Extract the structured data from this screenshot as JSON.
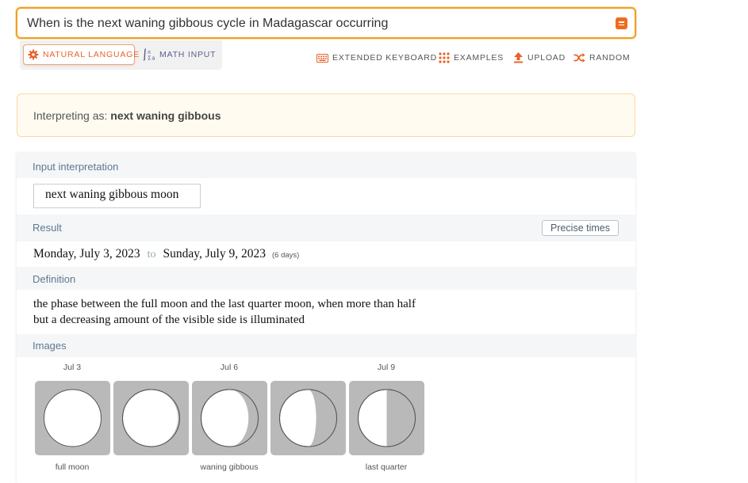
{
  "search": {
    "query": "When is the next waning gibbous cycle in Madagascar occurring"
  },
  "modes": {
    "natural_language": "NATURAL LANGUAGE",
    "math_input": "MATH INPUT"
  },
  "toolbar": {
    "extended_keyboard": "EXTENDED KEYBOARD",
    "examples": "EXAMPLES",
    "upload": "UPLOAD",
    "random": "RANDOM"
  },
  "interpretation": {
    "prefix": "Interpreting as: ",
    "value": "next waning gibbous"
  },
  "pods": {
    "input_interpretation": {
      "title": "Input interpretation",
      "value": "next waning gibbous moon"
    },
    "result": {
      "title": "Result",
      "precise_button": "Precise times",
      "start": "Monday, July 3, 2023",
      "to": "to",
      "end": "Sunday, July 9, 2023",
      "duration": "(6 days)"
    },
    "definition": {
      "title": "Definition",
      "line1": "the phase between the full moon and the last quarter moon, when more than half",
      "line2": "but a decreasing amount of the visible side is illuminated"
    },
    "images": {
      "title": "Images",
      "dates": [
        "Jul 3",
        "Jul 6",
        "Jul 9"
      ],
      "labels": [
        "full moon",
        "waning gibbous",
        "last quarter"
      ],
      "phases": [
        1.0,
        0.97,
        0.83,
        0.64,
        0.5
      ]
    }
  },
  "colors": {
    "accent": "#f26b1d",
    "search_border": "#f0a020",
    "pod_title": "#5f7890",
    "moon_tile": "#b9b9b9",
    "moon_shadow": "#b9b9b9"
  }
}
